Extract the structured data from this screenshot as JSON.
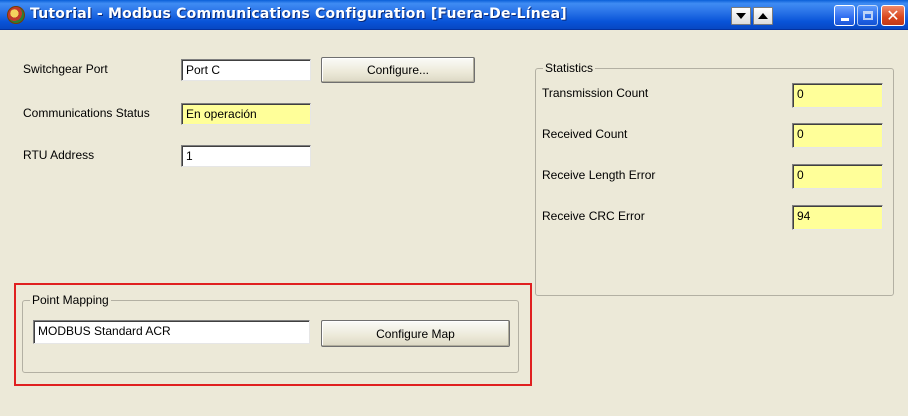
{
  "window": {
    "title": "Tutorial - Modbus Communications Configuration [Fuera-De-Línea]"
  },
  "icons": {
    "app": "app-icon",
    "scroll_down": "triangle-down-icon",
    "scroll_up": "triangle-up-icon",
    "minimize": "minimize-icon",
    "maximize": "maximize-icon",
    "close": "close-icon"
  },
  "close_glyph": "✕",
  "form": {
    "switchgear_port": {
      "label": "Switchgear Port",
      "value": "Port C"
    },
    "configure_button": "Configure...",
    "comm_status": {
      "label": "Communications Status",
      "value": "En operación"
    },
    "rtu_address": {
      "label": "RTU Address",
      "value": "1"
    }
  },
  "point_mapping": {
    "legend": "Point Mapping",
    "value": "MODBUS Standard ACR",
    "button": "Configure Map"
  },
  "statistics": {
    "legend": "Statistics",
    "rows": [
      {
        "label": "Transmission Count",
        "value": "0"
      },
      {
        "label": "Received Count",
        "value": "0"
      },
      {
        "label": "Receive Length Error",
        "value": "0"
      },
      {
        "label": "Receive CRC Error",
        "value": "94"
      }
    ]
  },
  "colors": {
    "highlight": "#e02020",
    "field_yellow": "#ffff99",
    "titlebar_blue": "#0853d8"
  }
}
